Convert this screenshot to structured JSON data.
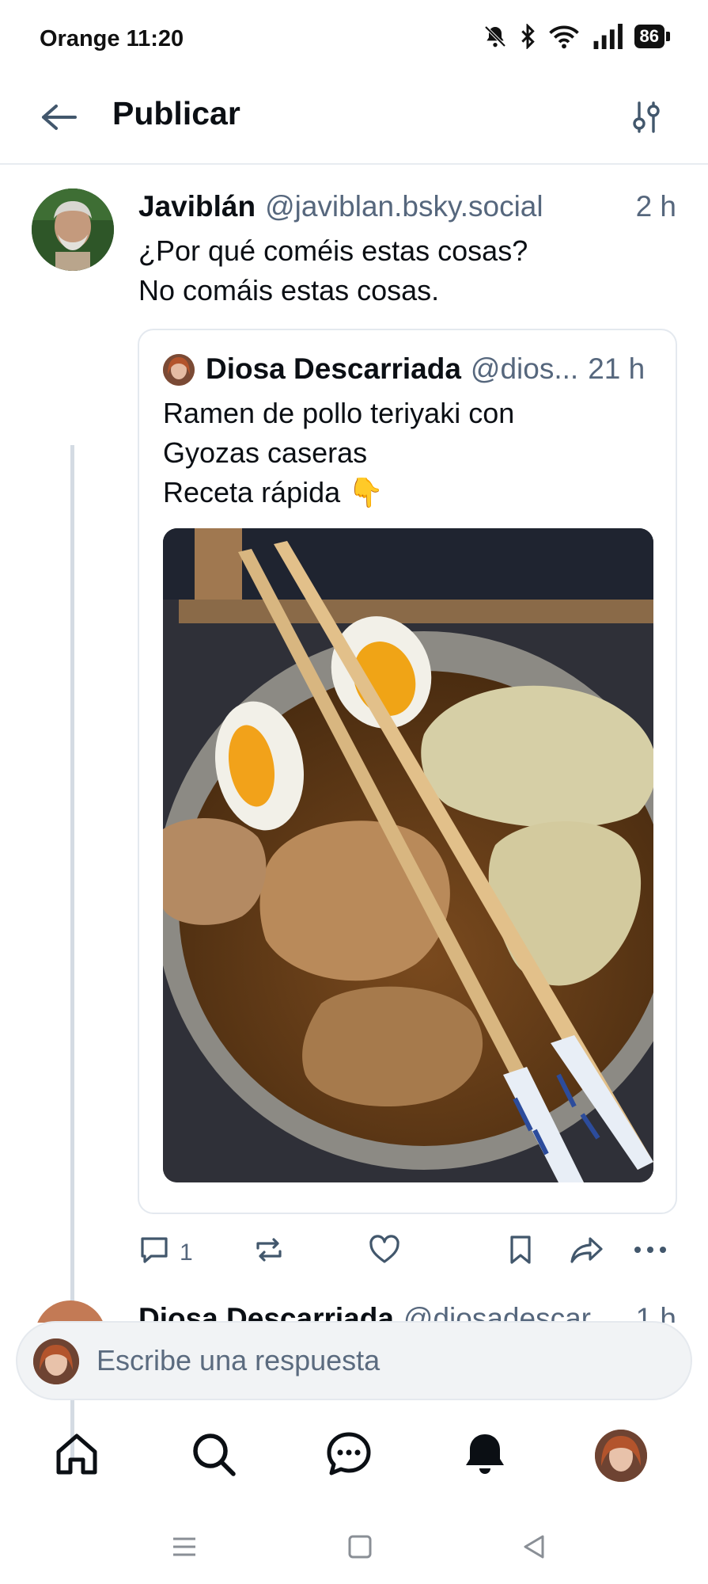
{
  "status_bar": {
    "carrier_time": "Orange 11:20",
    "battery": "86",
    "icons": [
      "mute-bell-icon",
      "bluetooth-icon",
      "wifi-icon",
      "signal-icon",
      "battery-icon"
    ]
  },
  "header": {
    "title": "Publicar",
    "back_icon": "arrow-left-icon",
    "settings_icon": "sliders-icon"
  },
  "post": {
    "author": "Javiblán",
    "handle": "@javiblan.bsky.social",
    "time": "2 h",
    "text": "¿Por qué coméis estas cosas?\nNo comáis estas cosas.",
    "quote": {
      "author": "Diosa Descarriada",
      "handle": "@dios...",
      "time": "21 h",
      "text": "Ramen de pollo teriyaki con\nGyozas caseras\nReceta rápida 👇"
    },
    "actions": {
      "reply_count": "1"
    }
  },
  "next_reply": {
    "author": "Diosa Descarriada",
    "handle": "@diosadescar...",
    "time": "1 h"
  },
  "reply_bar": {
    "placeholder": "Escribe una respuesta"
  },
  "bottom_nav": [
    "home-icon",
    "search-icon",
    "chat-icon",
    "bell-icon",
    "profile-avatar"
  ],
  "colors": {
    "text": "#0b0f14",
    "muted": "#56677d",
    "divider": "#e8ecf1",
    "icon_accent": "#42576c"
  }
}
